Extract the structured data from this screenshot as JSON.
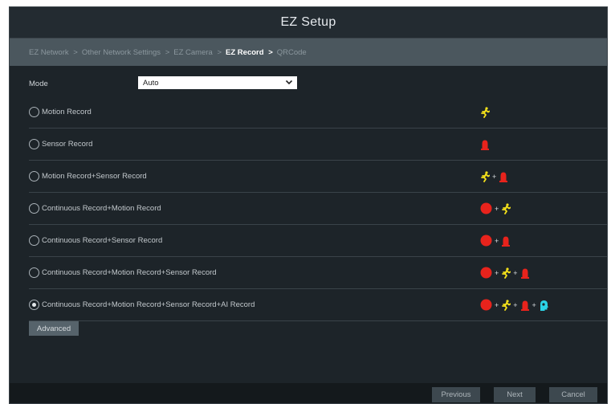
{
  "window": {
    "title": "EZ Setup"
  },
  "steps": [
    {
      "label": "EZ Network",
      "sep": ">",
      "active": false
    },
    {
      "label": "Other Network Settings",
      "sep": ">",
      "active": false
    },
    {
      "label": "EZ Camera",
      "sep": ">",
      "active": false
    },
    {
      "label": "EZ Record",
      "sep": ">",
      "active": true
    },
    {
      "label": "QRCode",
      "sep": "",
      "active": false
    }
  ],
  "mode": {
    "label": "Mode",
    "value": "Auto"
  },
  "options": [
    {
      "label": "Motion Record",
      "checked": false,
      "icons": [
        "motion"
      ]
    },
    {
      "label": "Sensor Record",
      "checked": false,
      "icons": [
        "sensor"
      ]
    },
    {
      "label": "Motion Record+Sensor Record",
      "checked": false,
      "icons": [
        "motion",
        "sensor"
      ]
    },
    {
      "label": "Continuous Record+Motion Record",
      "checked": false,
      "icons": [
        "continuous",
        "motion"
      ]
    },
    {
      "label": "Continuous Record+Sensor Record",
      "checked": false,
      "icons": [
        "continuous",
        "sensor"
      ]
    },
    {
      "label": "Continuous Record+Motion Record+Sensor Record",
      "checked": false,
      "icons": [
        "continuous",
        "motion",
        "sensor"
      ]
    },
    {
      "label": "Continuous Record+Motion Record+Sensor Record+AI Record",
      "checked": true,
      "icons": [
        "continuous",
        "motion",
        "sensor",
        "ai"
      ]
    }
  ],
  "plus_sign": "+",
  "buttons": {
    "advanced": "Advanced",
    "previous": "Previous",
    "next": "Next",
    "cancel": "Cancel"
  },
  "colors": {
    "motion": "#f5e21a",
    "sensor": "#e8231c",
    "continuous": "#e8231c",
    "ai": "#2bd3e6"
  }
}
